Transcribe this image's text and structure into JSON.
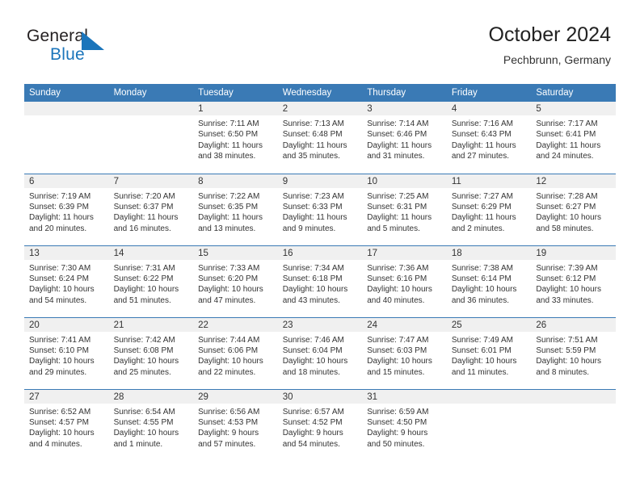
{
  "brand": {
    "name_part1": "General",
    "name_part2": "Blue",
    "logo_color": "#1b75bb",
    "text_color": "#231f20"
  },
  "header": {
    "title": "October 2024",
    "subtitle": "Pechbrunn, Germany"
  },
  "theme": {
    "header_blue": "#3a7ab5",
    "daynum_band": "#f0f0f0",
    "text": "#333333"
  },
  "weekday_headers": [
    "Sunday",
    "Monday",
    "Tuesday",
    "Wednesday",
    "Thursday",
    "Friday",
    "Saturday"
  ],
  "weeks": [
    [
      {
        "day": "",
        "sunrise": "",
        "sunset": "",
        "daylight_line1": "",
        "daylight_line2": "",
        "empty": true
      },
      {
        "day": "",
        "sunrise": "",
        "sunset": "",
        "daylight_line1": "",
        "daylight_line2": "",
        "empty": true
      },
      {
        "day": "1",
        "sunrise": "Sunrise: 7:11 AM",
        "sunset": "Sunset: 6:50 PM",
        "daylight_line1": "Daylight: 11 hours",
        "daylight_line2": "and 38 minutes."
      },
      {
        "day": "2",
        "sunrise": "Sunrise: 7:13 AM",
        "sunset": "Sunset: 6:48 PM",
        "daylight_line1": "Daylight: 11 hours",
        "daylight_line2": "and 35 minutes."
      },
      {
        "day": "3",
        "sunrise": "Sunrise: 7:14 AM",
        "sunset": "Sunset: 6:46 PM",
        "daylight_line1": "Daylight: 11 hours",
        "daylight_line2": "and 31 minutes."
      },
      {
        "day": "4",
        "sunrise": "Sunrise: 7:16 AM",
        "sunset": "Sunset: 6:43 PM",
        "daylight_line1": "Daylight: 11 hours",
        "daylight_line2": "and 27 minutes."
      },
      {
        "day": "5",
        "sunrise": "Sunrise: 7:17 AM",
        "sunset": "Sunset: 6:41 PM",
        "daylight_line1": "Daylight: 11 hours",
        "daylight_line2": "and 24 minutes."
      }
    ],
    [
      {
        "day": "6",
        "sunrise": "Sunrise: 7:19 AM",
        "sunset": "Sunset: 6:39 PM",
        "daylight_line1": "Daylight: 11 hours",
        "daylight_line2": "and 20 minutes."
      },
      {
        "day": "7",
        "sunrise": "Sunrise: 7:20 AM",
        "sunset": "Sunset: 6:37 PM",
        "daylight_line1": "Daylight: 11 hours",
        "daylight_line2": "and 16 minutes."
      },
      {
        "day": "8",
        "sunrise": "Sunrise: 7:22 AM",
        "sunset": "Sunset: 6:35 PM",
        "daylight_line1": "Daylight: 11 hours",
        "daylight_line2": "and 13 minutes."
      },
      {
        "day": "9",
        "sunrise": "Sunrise: 7:23 AM",
        "sunset": "Sunset: 6:33 PM",
        "daylight_line1": "Daylight: 11 hours",
        "daylight_line2": "and 9 minutes."
      },
      {
        "day": "10",
        "sunrise": "Sunrise: 7:25 AM",
        "sunset": "Sunset: 6:31 PM",
        "daylight_line1": "Daylight: 11 hours",
        "daylight_line2": "and 5 minutes."
      },
      {
        "day": "11",
        "sunrise": "Sunrise: 7:27 AM",
        "sunset": "Sunset: 6:29 PM",
        "daylight_line1": "Daylight: 11 hours",
        "daylight_line2": "and 2 minutes."
      },
      {
        "day": "12",
        "sunrise": "Sunrise: 7:28 AM",
        "sunset": "Sunset: 6:27 PM",
        "daylight_line1": "Daylight: 10 hours",
        "daylight_line2": "and 58 minutes."
      }
    ],
    [
      {
        "day": "13",
        "sunrise": "Sunrise: 7:30 AM",
        "sunset": "Sunset: 6:24 PM",
        "daylight_line1": "Daylight: 10 hours",
        "daylight_line2": "and 54 minutes."
      },
      {
        "day": "14",
        "sunrise": "Sunrise: 7:31 AM",
        "sunset": "Sunset: 6:22 PM",
        "daylight_line1": "Daylight: 10 hours",
        "daylight_line2": "and 51 minutes."
      },
      {
        "day": "15",
        "sunrise": "Sunrise: 7:33 AM",
        "sunset": "Sunset: 6:20 PM",
        "daylight_line1": "Daylight: 10 hours",
        "daylight_line2": "and 47 minutes."
      },
      {
        "day": "16",
        "sunrise": "Sunrise: 7:34 AM",
        "sunset": "Sunset: 6:18 PM",
        "daylight_line1": "Daylight: 10 hours",
        "daylight_line2": "and 43 minutes."
      },
      {
        "day": "17",
        "sunrise": "Sunrise: 7:36 AM",
        "sunset": "Sunset: 6:16 PM",
        "daylight_line1": "Daylight: 10 hours",
        "daylight_line2": "and 40 minutes."
      },
      {
        "day": "18",
        "sunrise": "Sunrise: 7:38 AM",
        "sunset": "Sunset: 6:14 PM",
        "daylight_line1": "Daylight: 10 hours",
        "daylight_line2": "and 36 minutes."
      },
      {
        "day": "19",
        "sunrise": "Sunrise: 7:39 AM",
        "sunset": "Sunset: 6:12 PM",
        "daylight_line1": "Daylight: 10 hours",
        "daylight_line2": "and 33 minutes."
      }
    ],
    [
      {
        "day": "20",
        "sunrise": "Sunrise: 7:41 AM",
        "sunset": "Sunset: 6:10 PM",
        "daylight_line1": "Daylight: 10 hours",
        "daylight_line2": "and 29 minutes."
      },
      {
        "day": "21",
        "sunrise": "Sunrise: 7:42 AM",
        "sunset": "Sunset: 6:08 PM",
        "daylight_line1": "Daylight: 10 hours",
        "daylight_line2": "and 25 minutes."
      },
      {
        "day": "22",
        "sunrise": "Sunrise: 7:44 AM",
        "sunset": "Sunset: 6:06 PM",
        "daylight_line1": "Daylight: 10 hours",
        "daylight_line2": "and 22 minutes."
      },
      {
        "day": "23",
        "sunrise": "Sunrise: 7:46 AM",
        "sunset": "Sunset: 6:04 PM",
        "daylight_line1": "Daylight: 10 hours",
        "daylight_line2": "and 18 minutes."
      },
      {
        "day": "24",
        "sunrise": "Sunrise: 7:47 AM",
        "sunset": "Sunset: 6:03 PM",
        "daylight_line1": "Daylight: 10 hours",
        "daylight_line2": "and 15 minutes."
      },
      {
        "day": "25",
        "sunrise": "Sunrise: 7:49 AM",
        "sunset": "Sunset: 6:01 PM",
        "daylight_line1": "Daylight: 10 hours",
        "daylight_line2": "and 11 minutes."
      },
      {
        "day": "26",
        "sunrise": "Sunrise: 7:51 AM",
        "sunset": "Sunset: 5:59 PM",
        "daylight_line1": "Daylight: 10 hours",
        "daylight_line2": "and 8 minutes."
      }
    ],
    [
      {
        "day": "27",
        "sunrise": "Sunrise: 6:52 AM",
        "sunset": "Sunset: 4:57 PM",
        "daylight_line1": "Daylight: 10 hours",
        "daylight_line2": "and 4 minutes."
      },
      {
        "day": "28",
        "sunrise": "Sunrise: 6:54 AM",
        "sunset": "Sunset: 4:55 PM",
        "daylight_line1": "Daylight: 10 hours",
        "daylight_line2": "and 1 minute."
      },
      {
        "day": "29",
        "sunrise": "Sunrise: 6:56 AM",
        "sunset": "Sunset: 4:53 PM",
        "daylight_line1": "Daylight: 9 hours",
        "daylight_line2": "and 57 minutes."
      },
      {
        "day": "30",
        "sunrise": "Sunrise: 6:57 AM",
        "sunset": "Sunset: 4:52 PM",
        "daylight_line1": "Daylight: 9 hours",
        "daylight_line2": "and 54 minutes."
      },
      {
        "day": "31",
        "sunrise": "Sunrise: 6:59 AM",
        "sunset": "Sunset: 4:50 PM",
        "daylight_line1": "Daylight: 9 hours",
        "daylight_line2": "and 50 minutes."
      },
      {
        "day": "",
        "sunrise": "",
        "sunset": "",
        "daylight_line1": "",
        "daylight_line2": "",
        "empty": true
      },
      {
        "day": "",
        "sunrise": "",
        "sunset": "",
        "daylight_line1": "",
        "daylight_line2": "",
        "empty": true
      }
    ]
  ]
}
